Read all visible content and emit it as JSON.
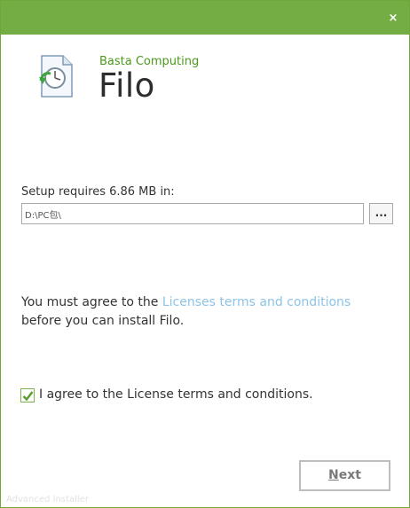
{
  "window": {
    "close_glyph": "×",
    "accent_color": "#74ad43"
  },
  "header": {
    "company": "Basta Computing",
    "product": "Filo",
    "icon": "setup-document-clock-icon"
  },
  "install": {
    "space_label": "Setup requires 6.86 MB in:",
    "path_value": "D:\\PC包\\",
    "browse_label": "..."
  },
  "license": {
    "text_before": "You must agree to the ",
    "link_text": "Licenses terms and conditions",
    "text_after": " before you can install Filo.",
    "checkbox_checked": true,
    "checkbox_label": "I agree to the License terms and conditions."
  },
  "footer": {
    "next_mnemonic": "N",
    "next_rest": "ext",
    "watermark": "Advanced Installer"
  }
}
